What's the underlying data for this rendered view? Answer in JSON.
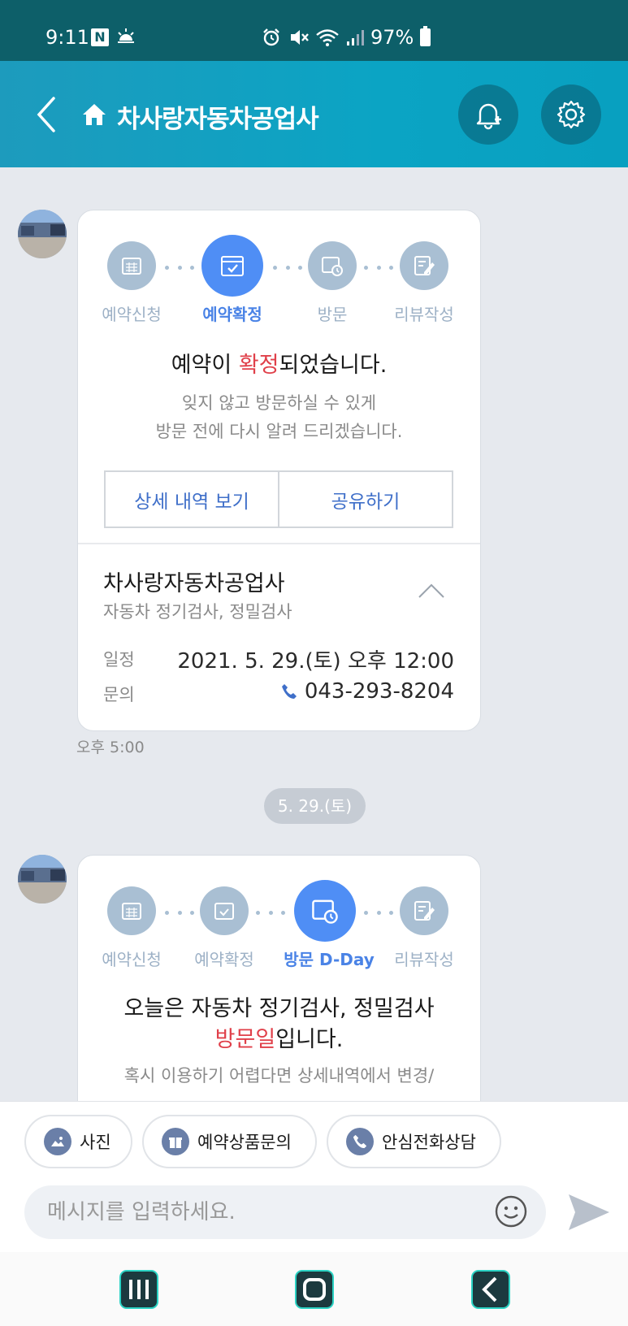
{
  "status_bar": {
    "time": "9:11",
    "notification_badge": "N",
    "battery": "97%"
  },
  "header": {
    "title": "차사랑자동차공업사"
  },
  "card1": {
    "steps": [
      "예약신청",
      "예약확정",
      "방문",
      "리뷰작성"
    ],
    "active_step": 1,
    "message_pre": "예약이 ",
    "message_highlight": "확정",
    "message_post": "되었습니다.",
    "sub_line1": "잊지 않고 방문하실 수 있게",
    "sub_line2": "방문 전에 다시 알려 드리겠습니다.",
    "detail_button": "상세 내역 보기",
    "share_button": "공유하기",
    "shop_name": "차사랑자동차공업사",
    "shop_services": "자동차 정기검사, 정밀검사",
    "schedule_label": "일정",
    "schedule_value": "2021. 5. 29.(토) 오후 12:00",
    "contact_label": "문의",
    "contact_value": "043-293-8204"
  },
  "card1_time": "오후 5:00",
  "date_separator": "5. 29.(토)",
  "card2": {
    "steps": [
      "예약신청",
      "예약확정",
      "방문 D-Day",
      "리뷰작성"
    ],
    "active_step": 2,
    "message_line1": "오늘은 자동차 정기검사, 정밀검사",
    "message_highlight": "방문일",
    "message_post": "입니다.",
    "sub_line1": "혹시 이용하기 어렵다면 상세내역에서 변경/"
  },
  "quick_actions": {
    "photo": "사진",
    "product_inquiry": "예약상품문의",
    "safe_call": "안심전화상담"
  },
  "message_input": {
    "placeholder": "메시지를 입력하세요."
  },
  "colors": {
    "status_bar": "#0d5f69",
    "header": "#0ba4c4",
    "active_step": "#4f8ef5",
    "inactive_step": "#a9bfd3",
    "highlight": "#e0404a",
    "link": "#3f6fc9"
  }
}
